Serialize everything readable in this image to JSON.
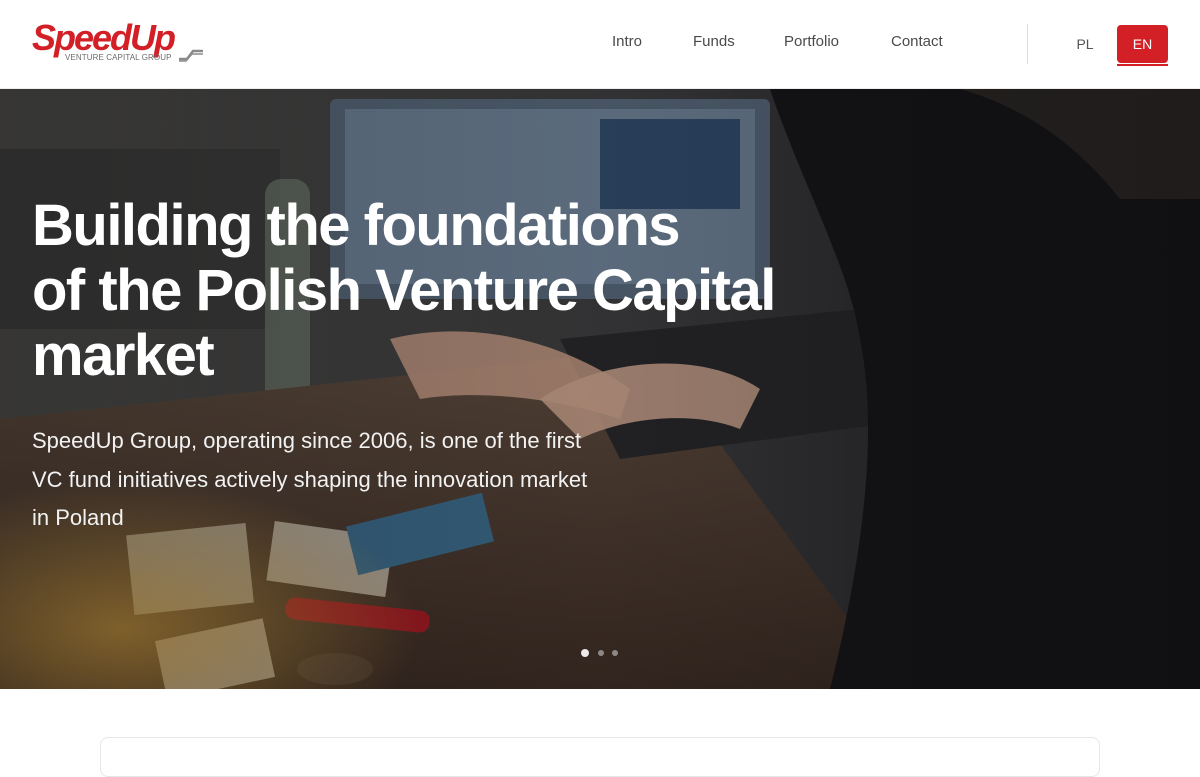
{
  "brand": {
    "name": "SpeedUp",
    "tagline": "VENTURE CAPITAL GROUP",
    "color": "#d31f26"
  },
  "nav": {
    "items": [
      {
        "label": "Intro"
      },
      {
        "label": "Funds"
      },
      {
        "label": "Portfolio"
      },
      {
        "label": "Contact"
      }
    ]
  },
  "lang": {
    "pl": "PL",
    "en": "EN",
    "active": "EN"
  },
  "hero": {
    "title_lines": [
      "Building the foundations",
      "of the Polish Venture Capital",
      "market"
    ],
    "text_lines": [
      "SpeedUp Group, operating since 2006, is one of the first",
      "VC fund initiatives actively shaping the innovation market",
      "in Poland"
    ],
    "slides_total": 3,
    "slide_active": 1
  }
}
